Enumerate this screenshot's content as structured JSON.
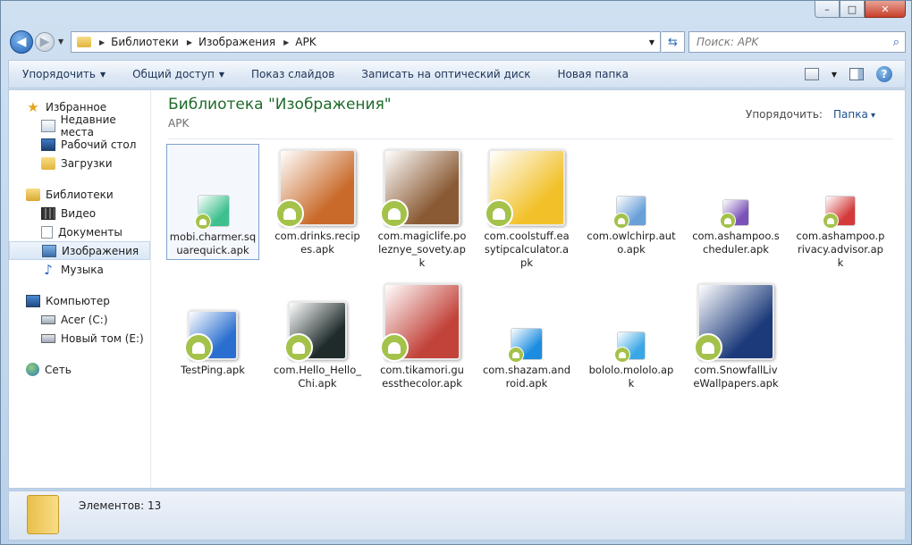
{
  "window": {
    "min_glyph": "–",
    "max_glyph": "□",
    "close_glyph": "✕"
  },
  "nav": {
    "back_glyph": "◀",
    "fwd_glyph": "▶"
  },
  "address": {
    "crumbs": [
      "Библиотеки",
      "Изображения",
      "APK"
    ]
  },
  "search": {
    "placeholder": "Поиск: APK"
  },
  "toolbar": {
    "organize": "Упорядочить",
    "share": "Общий доступ",
    "slideshow": "Показ слайдов",
    "burn": "Записать на оптический диск",
    "new_folder": "Новая папка",
    "help": "?"
  },
  "sidebar": {
    "favorites": "Избранное",
    "recent": "Недавние места",
    "desktop": "Рабочий стол",
    "downloads": "Загрузки",
    "libraries": "Библиотеки",
    "video": "Видео",
    "documents": "Документы",
    "images": "Изображения",
    "music": "Музыка",
    "computer": "Компьютер",
    "drive_c": "Acer (C:)",
    "drive_e": "Новый том (E:)",
    "network": "Сеть"
  },
  "main": {
    "title": "Библиотека \"Изображения\"",
    "subtitle": "APK",
    "arrange_label": "Упорядочить:",
    "arrange_value": "Папка"
  },
  "files": [
    {
      "name": "mobi.charmer.squarequick.apk",
      "color": "#3ec08e"
    },
    {
      "name": "com.drinks.recipes.apk",
      "color": "#c96a2a"
    },
    {
      "name": "com.magiclife.poleznye_sovety.apk",
      "color": "#8a5a34"
    },
    {
      "name": "com.coolstuff.easytipcalculator.apk",
      "color": "#f2c12a"
    },
    {
      "name": "com.owlchirp.auto.apk",
      "color": "#6aa0d8"
    },
    {
      "name": "com.ashampoo.scheduler.apk",
      "color": "#7b53b8"
    },
    {
      "name": "com.ashampoo.privacy.advisor.apk",
      "color": "#d43a3a"
    },
    {
      "name": "TestPing.apk",
      "color": "#2a6fd0"
    },
    {
      "name": "com.Hello_Hello_Chi.apk",
      "color": "#1f2b2b"
    },
    {
      "name": "com.tikamori.guessthecolor.apk",
      "color": "#c2433a"
    },
    {
      "name": "com.shazam.android.apk",
      "color": "#1a8de0"
    },
    {
      "name": "bololo.mololo.apk",
      "color": "#3aa8e6"
    },
    {
      "name": "com.SnowfallLiveWallpapers.apk",
      "color": "#1c3a7a"
    }
  ],
  "status": {
    "count": "Элементов: 13"
  }
}
